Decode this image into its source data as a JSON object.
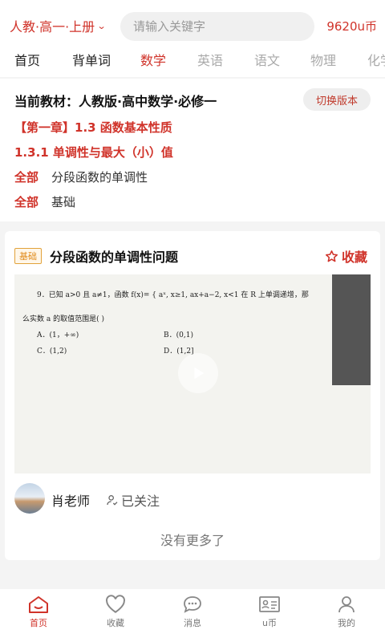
{
  "header": {
    "grade": "人教·高一·上册",
    "search_placeholder": "请输入关键字",
    "coins": "9620u币"
  },
  "tabs": [
    {
      "label": "首页",
      "state": "normal"
    },
    {
      "label": "背单词",
      "state": "normal"
    },
    {
      "label": "数学",
      "state": "active"
    },
    {
      "label": "英语",
      "state": "muted"
    },
    {
      "label": "语文",
      "state": "muted"
    },
    {
      "label": "物理",
      "state": "muted"
    },
    {
      "label": "化学",
      "state": "muted"
    }
  ],
  "material": {
    "title": "当前教材：人教版·高中数学·必修一",
    "switch_label": "切换版本",
    "chapter": "【第一章】1.3 函数基本性质",
    "section": "1.3.1 单调性与最大（小）值",
    "filters": [
      {
        "key": "全部",
        "value": "分段函数的单调性"
      },
      {
        "key": "全部",
        "value": "基础"
      }
    ]
  },
  "video": {
    "tag": "基础",
    "title": "分段函数的单调性问题",
    "collect_label": "收藏",
    "question": {
      "line1": "9．已知 a>0 且 a≠1，函数 f(x)= { aˣ, x≥1,  ax+a−2, x<1   在 R 上单调递增，那",
      "line2": "么实数 a 的取值范围是(      )",
      "opt_a": "A．(1，+∞)",
      "opt_b": "B．(0,1)",
      "opt_c": "C．(1,2)",
      "opt_d": "D．(1,2]"
    },
    "teacher": "肖老师",
    "follow_label": "已关注",
    "no_more": "没有更多了"
  },
  "bottom_nav": [
    {
      "label": "首页",
      "icon": "home-icon",
      "active": true
    },
    {
      "label": "收藏",
      "icon": "heart-icon",
      "active": false
    },
    {
      "label": "消息",
      "icon": "message-icon",
      "active": false
    },
    {
      "label": "u币",
      "icon": "card-icon",
      "active": false
    },
    {
      "label": "我的",
      "icon": "person-icon",
      "active": false
    }
  ],
  "colors": {
    "accent": "#d0332a",
    "tag": "#e08a1a"
  }
}
